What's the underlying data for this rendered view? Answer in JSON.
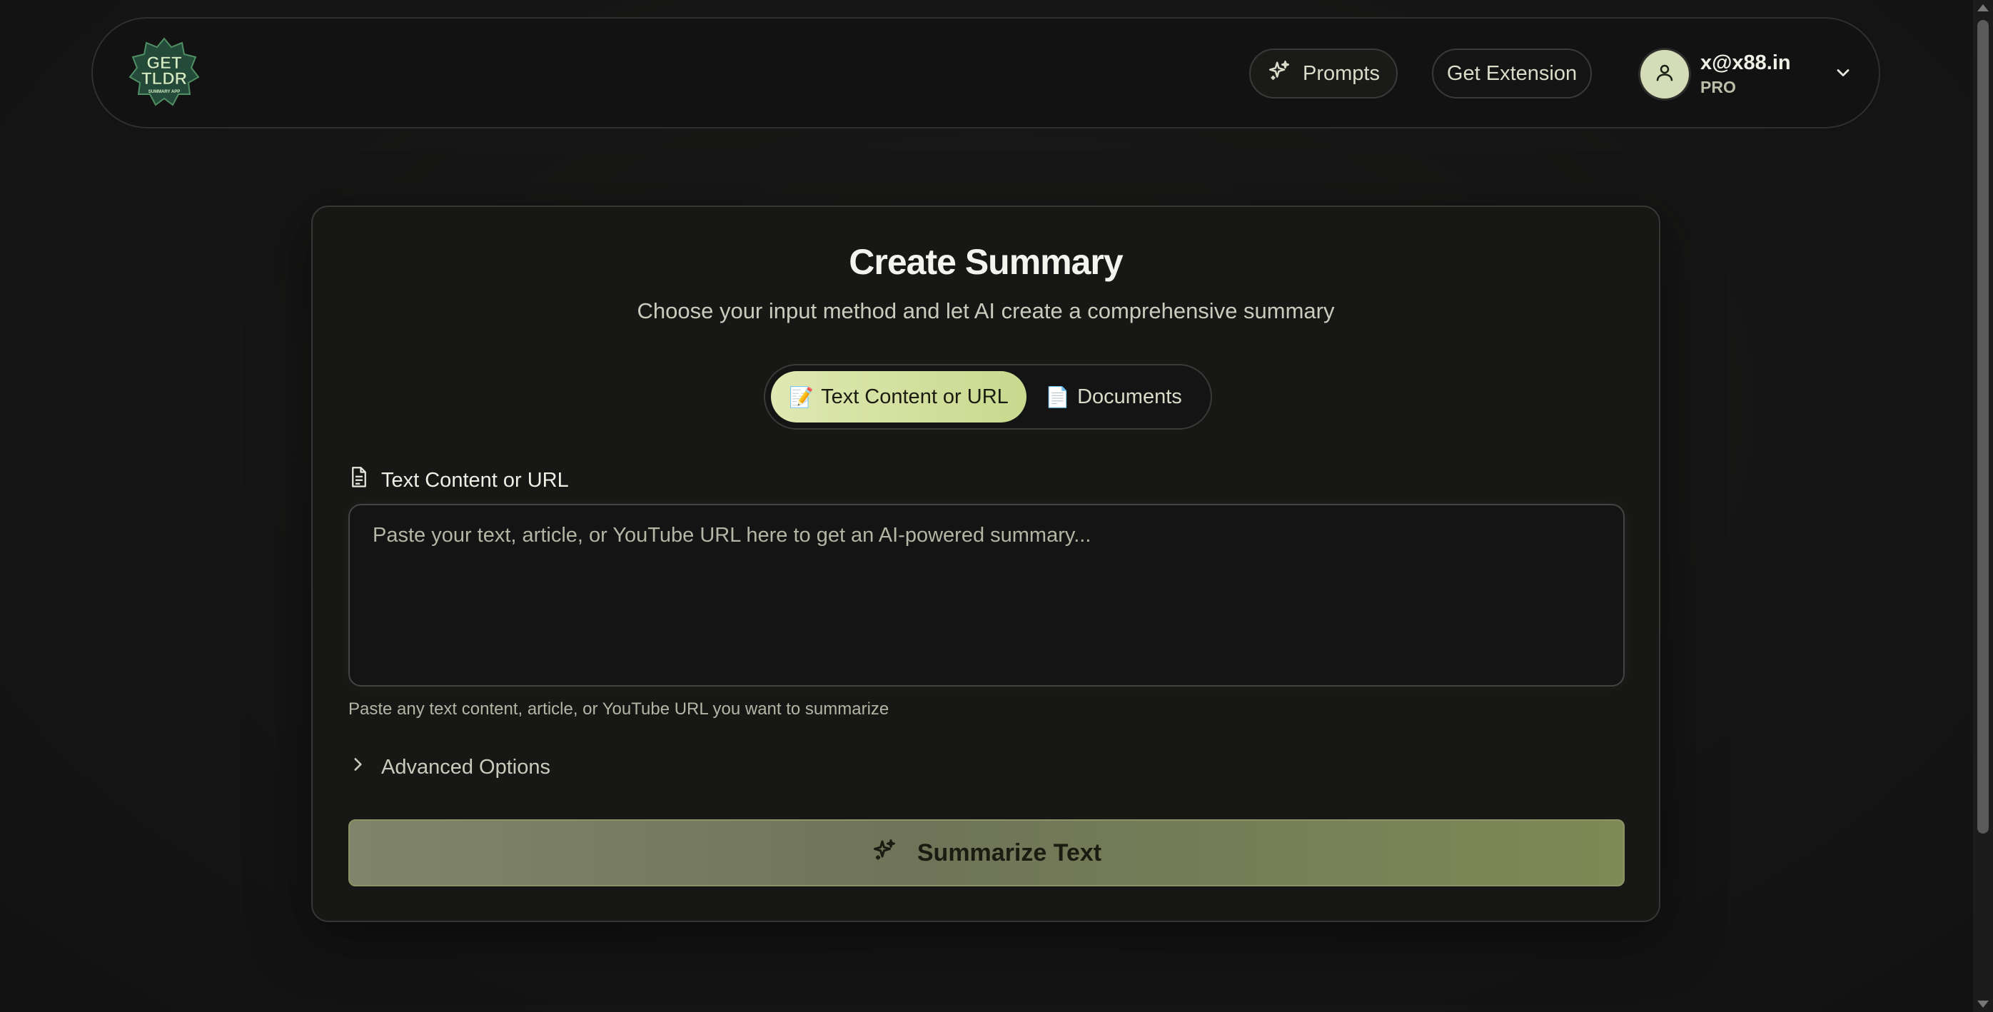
{
  "header": {
    "logo": {
      "text": "GET TLDR",
      "sub": "SUMMARY APP"
    },
    "prompts_label": "Prompts",
    "extension_label": "Get Extension",
    "user": {
      "email": "x@x88.in",
      "plan": "PRO"
    }
  },
  "main": {
    "title": "Create Summary",
    "subtitle": "Choose your input method and let AI create a comprehensive summary",
    "tabs": [
      {
        "emoji": "📝",
        "label": "Text Content or URL",
        "active": true
      },
      {
        "emoji": "📄",
        "label": "Documents",
        "active": false
      }
    ],
    "field_label": "Text Content or URL",
    "textarea_placeholder": "Paste your text, article, or YouTube URL here to get an AI-powered summary...",
    "textarea_value": "",
    "helper_text": "Paste any text content, article, or YouTube URL you want to summarize",
    "advanced_label": "Advanced Options",
    "submit_label": "Summarize Text"
  },
  "colors": {
    "background": "#151515",
    "accent": "#d4dcb8",
    "active_tab": "#dfe8b2",
    "submit": "#7d8a55"
  },
  "icons": {
    "prompts": "sparkles-icon",
    "user": "user-icon",
    "dropdown": "chevron-down-icon",
    "field": "document-icon",
    "advanced": "chevron-right-icon",
    "submit": "sparkles-icon"
  }
}
